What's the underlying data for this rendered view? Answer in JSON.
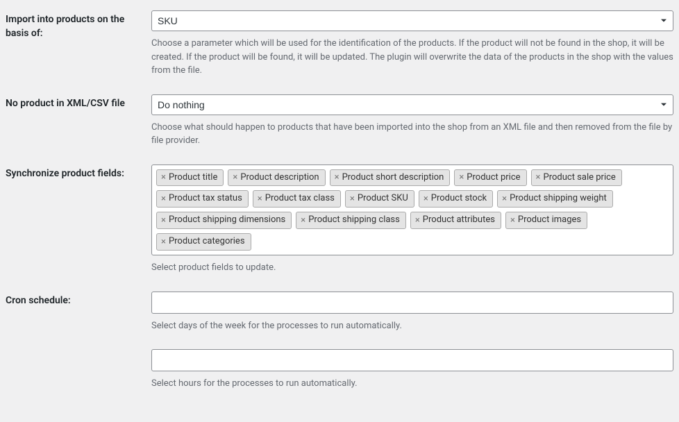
{
  "fields": {
    "import_basis": {
      "label": "Import into products on the basis of:",
      "value": "SKU",
      "description": "Choose a parameter which will be used for the identification of the products. If the product will not be found in the shop, it will be created. If the product will be found, it will be updated. The plugin will overwrite the data of the products in the shop with the values from the file."
    },
    "no_product": {
      "label": "No product in XML/CSV file",
      "value": "Do nothing",
      "description": "Choose what should happen to products that have been imported into the shop from an XML file and then removed from the file by file provider."
    },
    "sync_fields": {
      "label": "Synchronize product fields:",
      "description": "Select product fields to update.",
      "tags": [
        "Product title",
        "Product description",
        "Product short description",
        "Product price",
        "Product sale price",
        "Product tax status",
        "Product tax class",
        "Product SKU",
        "Product stock",
        "Product shipping weight",
        "Product shipping dimensions",
        "Product shipping class",
        "Product attributes",
        "Product images",
        "Product categories"
      ]
    },
    "cron": {
      "label": "Cron schedule:",
      "days_description": "Select days of the week for the processes to run automatically.",
      "hours_description": "Select hours for the processes to run automatically."
    }
  },
  "remove_glyph": "×"
}
